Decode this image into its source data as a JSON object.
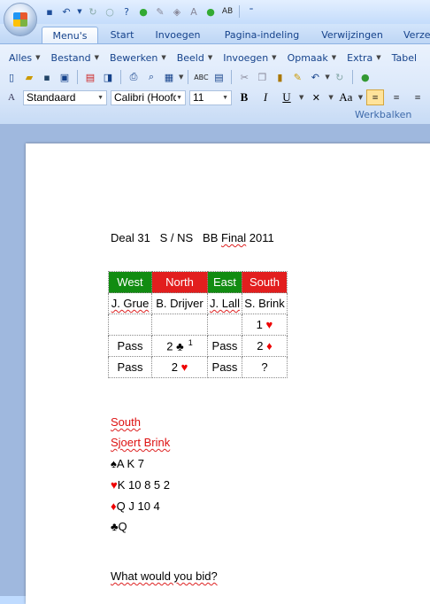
{
  "quick_access": {
    "icons": [
      "save-icon",
      "undo-icon",
      "redo-icon",
      "repeat-icon",
      "help-icon",
      "green-circle-icon",
      "highlight-icon",
      "fill-color-icon",
      "font-color-icon",
      "green-circle-icon",
      "spelling-icon",
      "customize-icon"
    ]
  },
  "tabs": [
    "Menu's",
    "Start",
    "Invoegen",
    "Pagina-indeling",
    "Verwijzingen",
    "Verze"
  ],
  "active_tab": "Menu's",
  "menu_row": [
    "Alles",
    "Bestand",
    "Bewerken",
    "Beeld",
    "Invoegen",
    "Opmaak",
    "Extra",
    "Tabel"
  ],
  "format_row": {
    "style": "Standaard",
    "font": "Calibri (Hoofd",
    "size": "11",
    "bold": "B",
    "italic": "I",
    "underline": "U",
    "case": "Aa"
  },
  "group_label": "Werkbalken",
  "document": {
    "heading": {
      "part1": "Deal 31   S / NS   BB ",
      "final": "Final",
      "year": " 2011"
    },
    "table": {
      "headers": [
        {
          "text": "West",
          "color": "green"
        },
        {
          "text": "North",
          "color": "red"
        },
        {
          "text": "East",
          "color": "green"
        },
        {
          "text": "South",
          "color": "red"
        }
      ],
      "names": [
        "J. Grue",
        "B. Drijver",
        "J. Lall",
        "S. Brink"
      ],
      "rows": [
        [
          {
            "t": ""
          },
          {
            "t": ""
          },
          {
            "t": ""
          },
          {
            "t": "1",
            "suit": "♥"
          }
        ],
        [
          {
            "t": "Pass"
          },
          {
            "t": "2",
            "suit": "♣",
            "note": "1"
          },
          {
            "t": "Pass"
          },
          {
            "t": "2",
            "suit": "♦"
          }
        ],
        [
          {
            "t": "Pass"
          },
          {
            "t": "2",
            "suit": "♥"
          },
          {
            "t": "Pass"
          },
          {
            "t": "?"
          }
        ]
      ]
    },
    "seat": "South",
    "player": "Sjoert Brink",
    "hand": [
      {
        "suit": "♠",
        "color": "black",
        "cards": "A K 7"
      },
      {
        "suit": "♥",
        "color": "red",
        "cards": "K 10 8 5 2"
      },
      {
        "suit": "♦",
        "color": "red",
        "cards": "Q J 10 4"
      },
      {
        "suit": "♣",
        "color": "black",
        "cards": "Q"
      }
    ],
    "question": "What would you bid?"
  }
}
